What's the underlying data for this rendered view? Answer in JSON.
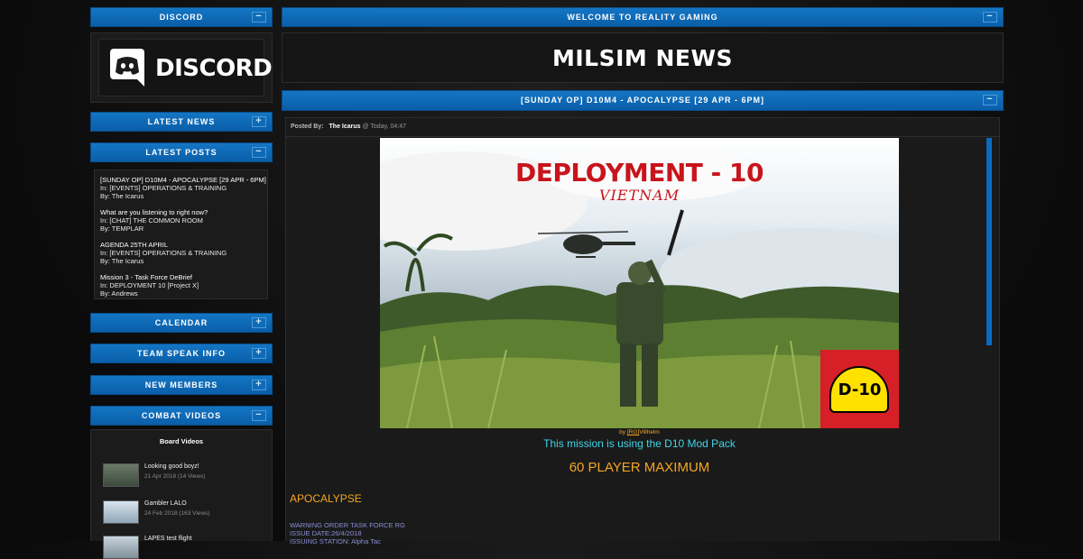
{
  "sidebar": {
    "discord": {
      "title": "DISCORD",
      "toggle": "−",
      "logo_text": "DISCORD"
    },
    "latest_news": {
      "title": "LATEST NEWS",
      "toggle": "+"
    },
    "latest_posts": {
      "title": "LATEST POSTS",
      "toggle": "−",
      "posts": [
        {
          "title": "[SUNDAY OP] D10M4 - APOCALYPSE [29 APR - 6PM]",
          "in": "In: [EVENTS] OPERATIONS & TRAINING",
          "by": "By: The Icarus"
        },
        {
          "title": "What are you listening to right now?",
          "in": "In: [CHAT] THE COMMON ROOM",
          "by": "By: TEMPLAR"
        },
        {
          "title": "AGENDA 25TH APRIL",
          "in": "In: [EVENTS] OPERATIONS & TRAINING",
          "by": "By: The Icarus"
        },
        {
          "title": "Mission 3 - Task Force DeBrief",
          "in": "In: DEPLOYMENT 10 [Project X]",
          "by": "By: Andrews"
        }
      ]
    },
    "calendar": {
      "title": "CALENDAR",
      "toggle": "+"
    },
    "teamspeak": {
      "title": "TEAM SPEAK INFO",
      "toggle": "+"
    },
    "new_members": {
      "title": "NEW MEMBERS",
      "toggle": "+"
    },
    "combat_videos": {
      "title": "COMBAT VIDEOS",
      "toggle": "−",
      "board_title": "Board Videos",
      "videos": [
        {
          "title": "Looking good boyz!",
          "meta": "21 Apr 2018 (14 Views)"
        },
        {
          "title": "Gambler LALO",
          "meta": "24 Feb 2018 (163 Views)"
        },
        {
          "title": "LAPES test flight",
          "meta": ""
        }
      ]
    }
  },
  "main": {
    "welcome": {
      "title": "WELCOME TO REALITY GAMING",
      "toggle": "−"
    },
    "banner_title": "MILSIM NEWS",
    "topic": {
      "title": "[SUNDAY OP] D10M4 - APOCALYPSE [29 APR - 6PM]",
      "toggle": "−"
    },
    "post": {
      "posted_by_label": "Posted By:",
      "author": "The Icarus",
      "time": "@ Today, 04:47",
      "image_title": "DEPLOYMENT - 10",
      "image_subtitle": "VIETNAM",
      "logo_text": "D-10",
      "credit_prefix": "by",
      "credit_link": "[RG]",
      "credit_name": "Villhelm",
      "modpack": "This mission is using the D10 Mod Pack",
      "max_players": "60 PLAYER MAXIMUM",
      "section_title": "APOCALYPSE",
      "line1": "WARNING ORDER TASK FORCE RG",
      "line2": "ISSUE DATE:26/4/2018",
      "line3": "ISSUING STATION: Alpha Tac"
    }
  },
  "colors": {
    "accent": "#0a6cc0",
    "gold": "#f5a623",
    "cyan": "#3fd6e8",
    "link_purple": "#8d8dd8"
  }
}
